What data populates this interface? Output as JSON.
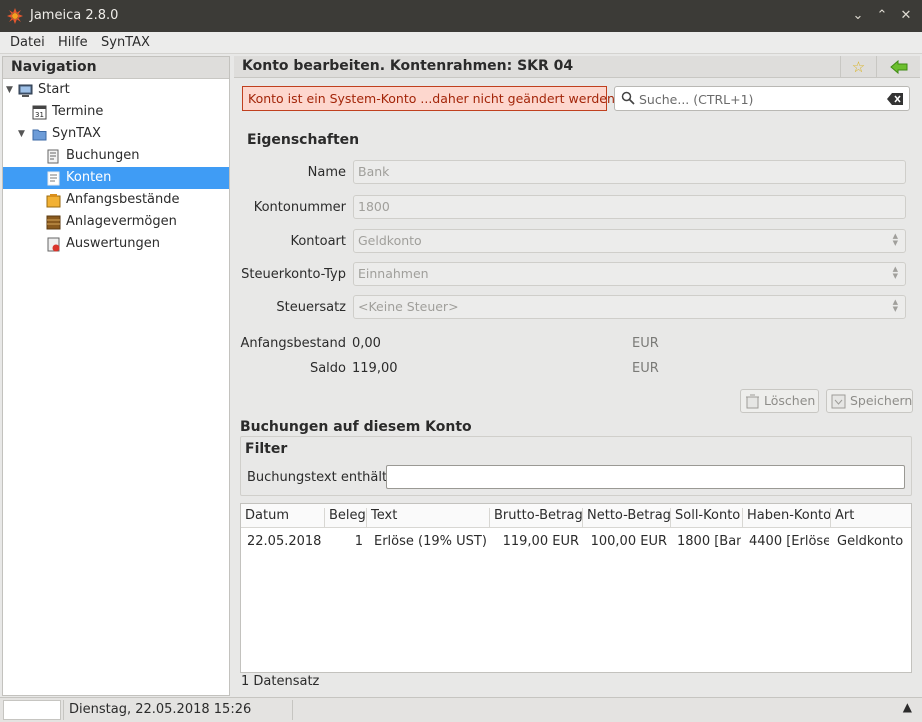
{
  "window": {
    "title": "Jameica 2.8.0"
  },
  "menu": [
    "Datei",
    "Hilfe",
    "SynTAX"
  ],
  "navigation": {
    "header": "Navigation",
    "items": [
      {
        "label": "Start",
        "icon": "computer-icon"
      },
      {
        "label": "Termine",
        "icon": "calendar-icon"
      },
      {
        "label": "SynTAX",
        "icon": "folder-icon"
      },
      {
        "label": "Buchungen",
        "icon": "bookings-icon"
      },
      {
        "label": "Konten",
        "icon": "accounts-icon"
      },
      {
        "label": "Anfangsbestände",
        "icon": "opening-balance-icon"
      },
      {
        "label": "Anlagevermögen",
        "icon": "assets-icon"
      },
      {
        "label": "Auswertungen",
        "icon": "reports-icon"
      }
    ],
    "calendar_icon_text": "31",
    "selected": "Konten"
  },
  "main": {
    "title": "Konto bearbeiten. Kontenrahmen: SKR 04",
    "warning": "Konto ist ein System-Konto ...daher nicht geändert werden",
    "search_placeholder": "Suche...   (CTRL+1)",
    "properties_title": "Eigenschaften",
    "fields": {
      "name_label": "Name",
      "name_value": "Bank",
      "number_label": "Kontonummer",
      "number_value": "1800",
      "type_label": "Kontoart",
      "type_value": "Geldkonto",
      "tax_type_label": "Steuerkonto-Typ",
      "tax_type_value": "Einnahmen",
      "tax_rate_label": "Steuersatz",
      "tax_rate_value": "<Keine Steuer>",
      "opening_label": "Anfangsbestand",
      "opening_value": "0,00",
      "opening_currency": "EUR",
      "balance_label": "Saldo",
      "balance_value": "119,00",
      "balance_currency": "EUR"
    },
    "buttons": {
      "delete": "Löschen",
      "save": "Speichern"
    },
    "bookings_title": "Buchungen auf diesem Konto",
    "filter_title": "Filter",
    "filter_label": "Buchungstext enthält",
    "filter_value": "",
    "table": {
      "columns": [
        "Datum",
        "Beleg",
        "Text",
        "Brutto-Betrag",
        "Netto-Betrag",
        "Soll-Konto",
        "Haben-Konto",
        "Art"
      ],
      "rows": [
        [
          "22.05.2018",
          "1",
          "Erlöse (19% UST)",
          "119,00 EUR",
          "100,00 EUR",
          "1800 [Ban",
          "4400 [Erlöse",
          "Geldkonto"
        ]
      ]
    },
    "record_count": "1 Datensatz"
  },
  "statusbar": {
    "datetime": "Dienstag, 22.05.2018 15:26"
  },
  "colors": {
    "selection": "#3f9cf5",
    "warning_bg": "#fdd7ce",
    "warning_border": "#c0401f",
    "titlebar": "#3c3b37"
  }
}
